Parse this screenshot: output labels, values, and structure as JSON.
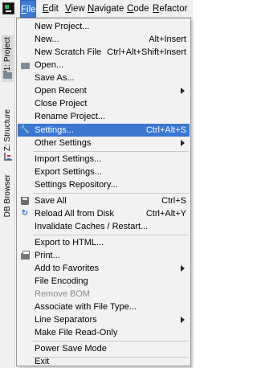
{
  "menubar": {
    "items": [
      {
        "label": "File",
        "mnemonic": "F",
        "rest": "ile",
        "active": true
      },
      {
        "label": "Edit",
        "mnemonic": "E",
        "rest": "dit"
      },
      {
        "label": "View",
        "mnemonic": "V",
        "rest": "iew"
      },
      {
        "label": "Navigate",
        "mnemonic": "N",
        "rest": "avigate"
      },
      {
        "label": "Code",
        "mnemonic": "C",
        "rest": "ode"
      },
      {
        "label": "Refactor",
        "mnemonic": "R",
        "rest": "efactor"
      }
    ]
  },
  "left_strip": {
    "tabs": [
      {
        "label": "1: Project",
        "icon": "folder-icon"
      },
      {
        "label": "Z: Structure",
        "icon": "structure-icon"
      },
      {
        "label": "DB Browser"
      }
    ]
  },
  "file_menu": {
    "items": [
      {
        "label": "New Project..."
      },
      {
        "label": "New...",
        "shortcut": "Alt+Insert"
      },
      {
        "label": "New Scratch File",
        "shortcut": "Ctrl+Alt+Shift+Insert"
      },
      {
        "label": "Open...",
        "icon": "folder-open-icon"
      },
      {
        "label": "Save As..."
      },
      {
        "label": "Open Recent",
        "submenu": true
      },
      {
        "label": "Close Project"
      },
      {
        "label": "Rename Project..."
      },
      {
        "label": "Settings...",
        "shortcut": "Ctrl+Alt+S",
        "icon": "wrench-icon",
        "selected": true
      },
      {
        "label": "Other Settings",
        "submenu": true
      },
      {
        "label": "Import Settings..."
      },
      {
        "label": "Export Settings..."
      },
      {
        "label": "Settings Repository..."
      },
      {
        "label": "Save All",
        "shortcut": "Ctrl+S",
        "icon": "save-icon"
      },
      {
        "label": "Reload All from Disk",
        "shortcut": "Ctrl+Alt+Y",
        "icon": "reload-icon"
      },
      {
        "label": "Invalidate Caches / Restart..."
      },
      {
        "label": "Export to HTML..."
      },
      {
        "label": "Print...",
        "icon": "print-icon"
      },
      {
        "label": "Add to Favorites",
        "submenu": true
      },
      {
        "label": "File Encoding"
      },
      {
        "label": "Remove BOM",
        "disabled": true
      },
      {
        "label": "Associate with File Type..."
      },
      {
        "label": "Line Separators",
        "submenu": true
      },
      {
        "label": "Make File Read-Only"
      },
      {
        "label": "Power Save Mode"
      },
      {
        "label": "Exit"
      }
    ]
  },
  "colors": {
    "selection": "#3a76d2",
    "menu_background": "#f2f2f2",
    "disabled_text": "#8c8c8c"
  }
}
